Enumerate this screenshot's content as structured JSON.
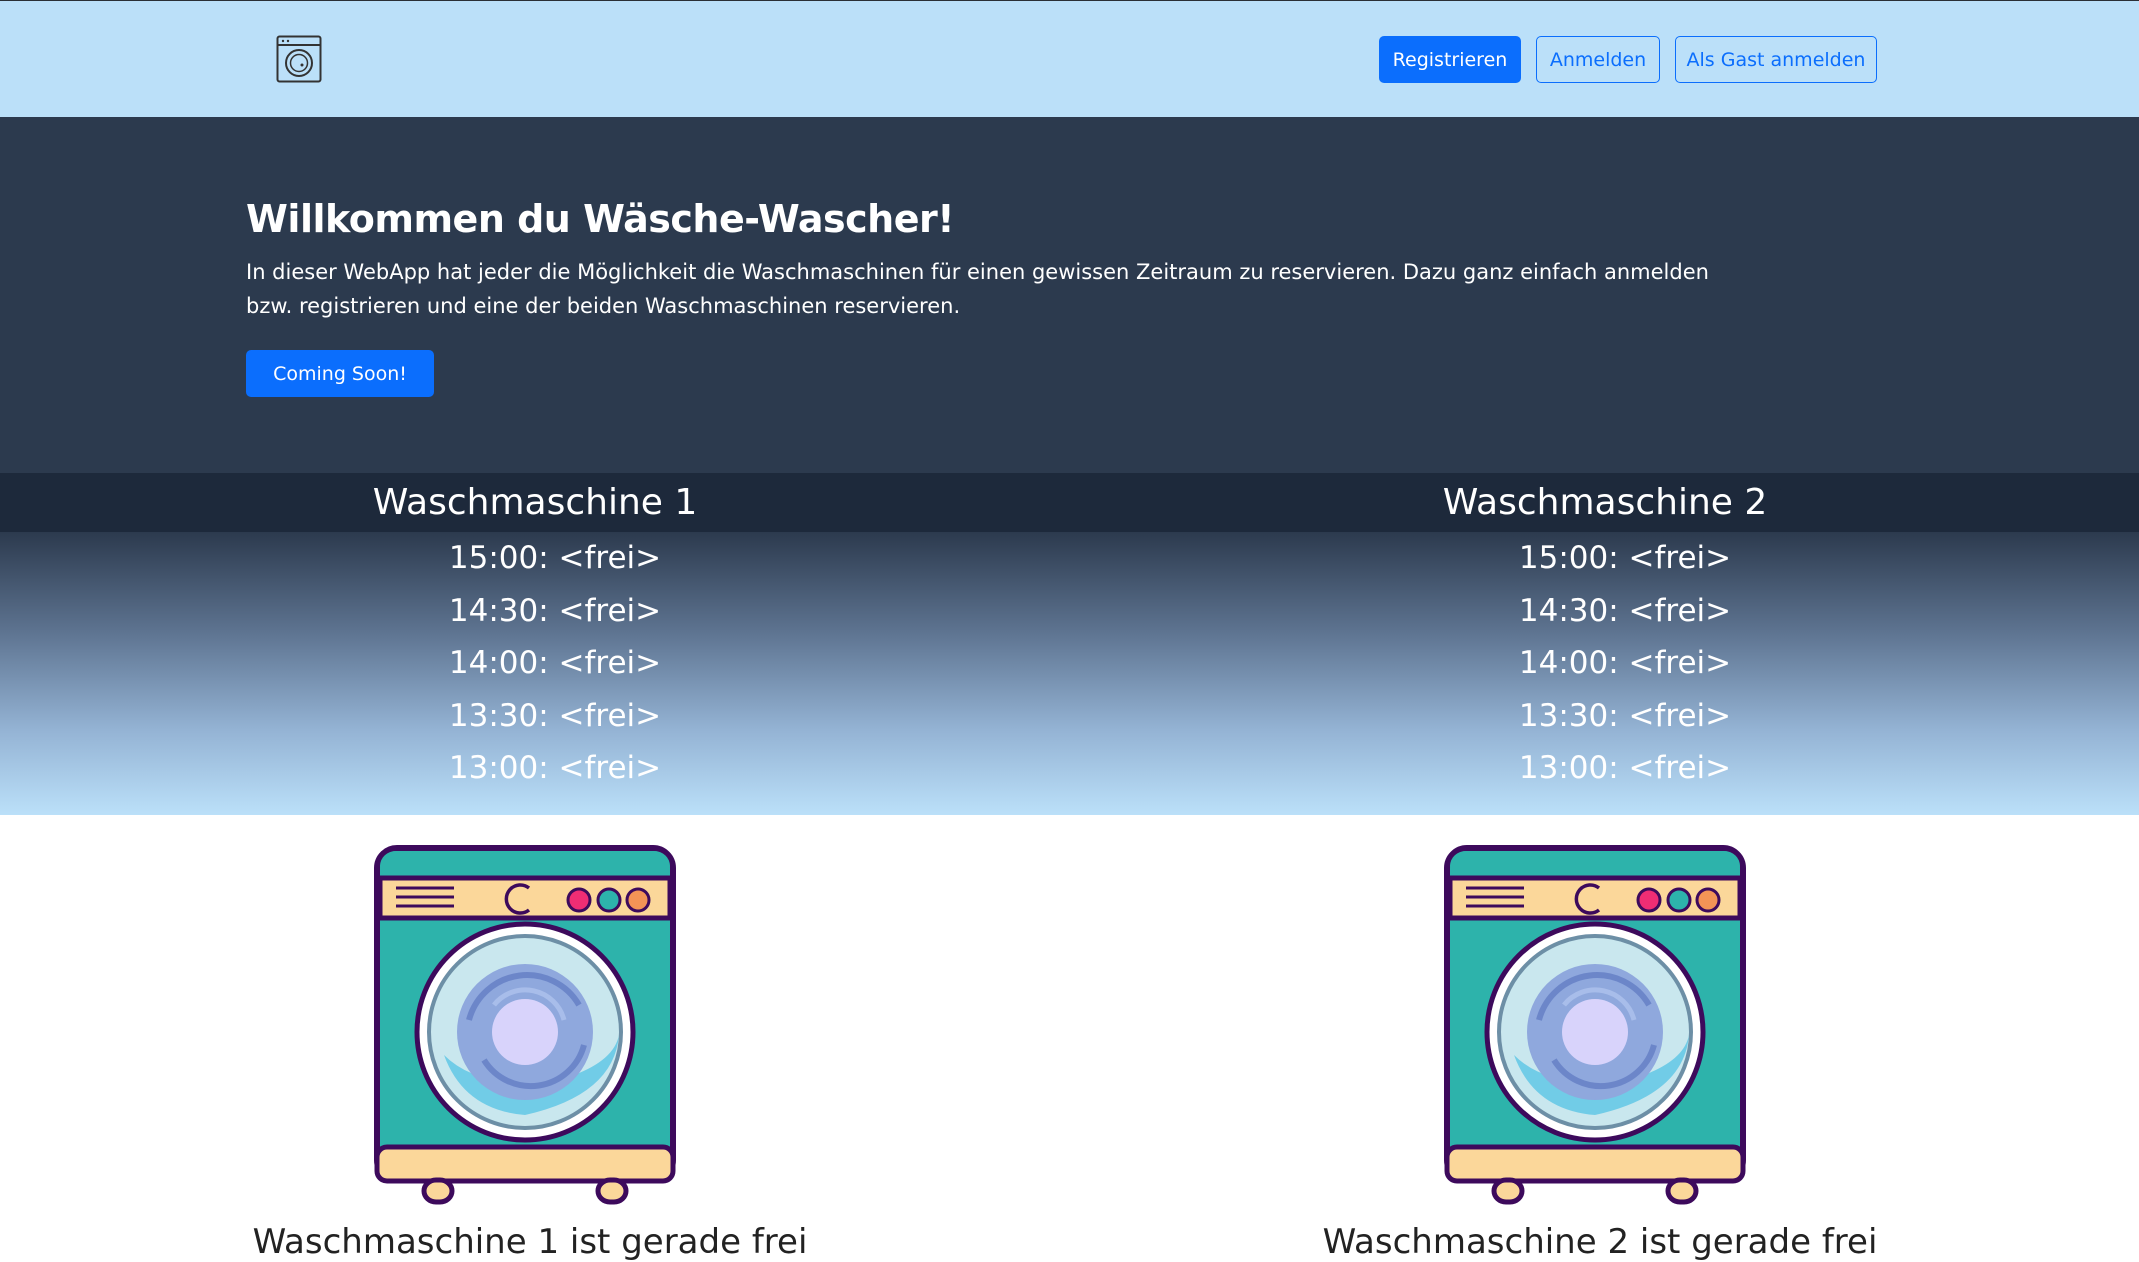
{
  "nav": {
    "register_label": "Registrieren",
    "login_label": "Anmelden",
    "guest_label": "Als Gast anmelden"
  },
  "hero": {
    "title": "Willkommen du Wäsche-Wascher!",
    "text": "In dieser WebApp hat jeder die Möglichkeit die Waschmaschinen für einen gewissen Zeitraum zu reservieren. Dazu ganz einfach anmelden bzw. registrieren und eine der beiden Waschmaschinen reservieren.",
    "button_label": "Coming Soon!"
  },
  "machines": [
    {
      "title": "Waschmaschine 1",
      "slots": [
        "15:00: <frei>",
        "14:30: <frei>",
        "14:00: <frei>",
        "13:30: <frei>",
        "13:00: <frei>"
      ],
      "caption": "Waschmaschine 1 ist gerade frei"
    },
    {
      "title": "Waschmaschine 2",
      "slots": [
        "15:00: <frei>",
        "14:30: <frei>",
        "14:00: <frei>",
        "13:30: <frei>",
        "13:00: <frei>"
      ],
      "caption": "Waschmaschine 2 ist gerade frei"
    }
  ],
  "colors": {
    "navbar_bg": "#bbe0f9",
    "hero_bg": "#2c3a4e",
    "header_bar": "#1d293b",
    "primary": "#0b6efd"
  },
  "icons": {
    "logo": "washing-machine-outline-icon",
    "machine_image": "washing-machine-illustration"
  }
}
